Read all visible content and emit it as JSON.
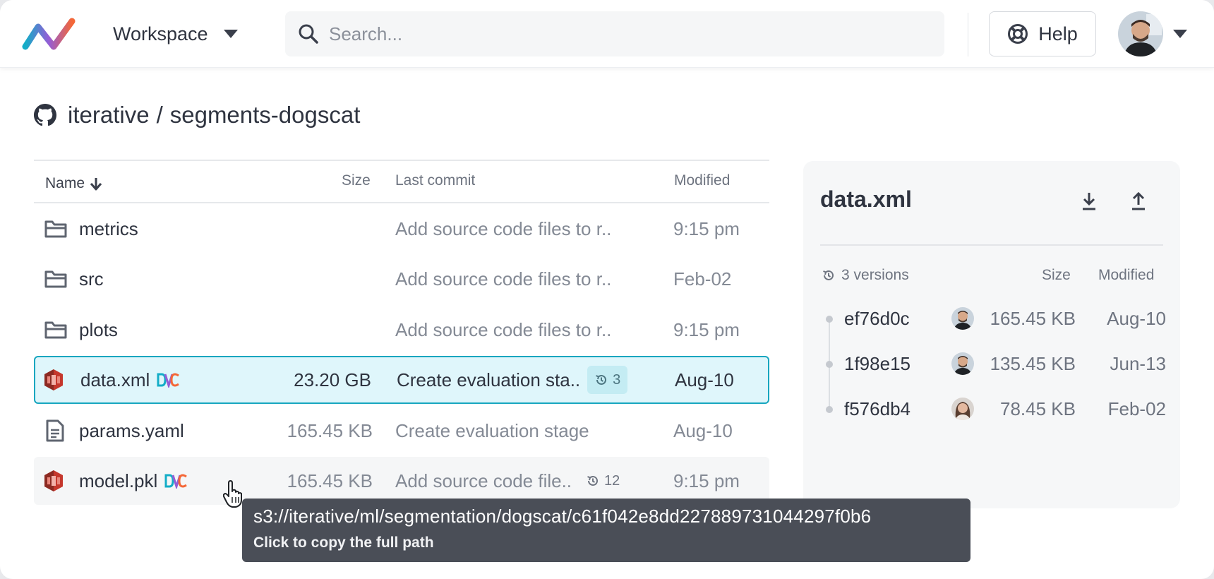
{
  "header": {
    "workspace_label": "Workspace",
    "search_placeholder": "Search...",
    "help_label": "Help"
  },
  "repo": {
    "owner": "iterative",
    "separator": "/",
    "name": "segments-dogscat"
  },
  "table": {
    "columns": {
      "name": "Name",
      "size": "Size",
      "last_commit": "Last commit",
      "modified": "Modified"
    },
    "rows": [
      {
        "name": "metrics",
        "type": "folder",
        "size": "",
        "commit": "Add source code files to r..",
        "modified": "9:15 pm"
      },
      {
        "name": "src",
        "type": "folder",
        "size": "",
        "commit": "Add source code files to r..",
        "modified": "Feb-02"
      },
      {
        "name": "plots",
        "type": "folder",
        "size": "",
        "commit": "Add source code files to r..",
        "modified": "9:15 pm"
      },
      {
        "name": "data.xml",
        "type": "s3-file",
        "dvc": true,
        "size": "23.20 GB",
        "commit": "Create evaluation sta..",
        "versions": "3",
        "modified": "Aug-10",
        "selected": true
      },
      {
        "name": "params.yaml",
        "type": "document",
        "size": "165.45 KB",
        "commit": "Create evaluation stage",
        "modified": "Aug-10"
      },
      {
        "name": "model.pkl",
        "type": "s3-file",
        "dvc": true,
        "size": "165.45 KB",
        "commit": "Add source code file..",
        "versions": "12",
        "modified": "9:15 pm",
        "hover": true
      }
    ]
  },
  "tooltip": {
    "path": "s3://iterative/ml/segmentation/dogscat/c61f042e8dd227889731044297f0b6",
    "hint": "Click to copy the full path"
  },
  "panel": {
    "title": "data.xml",
    "versions_label": "3 versions",
    "size_label": "Size",
    "modified_label": "Modified",
    "versions": [
      {
        "hash": "ef76d0c",
        "size": "165.45 KB",
        "modified": "Aug-10"
      },
      {
        "hash": "1f98e15",
        "size": "135.45 KB",
        "modified": "Jun-13"
      },
      {
        "hash": "f576db4",
        "size": "78.45 KB",
        "modified": "Feb-02"
      }
    ]
  },
  "colors": {
    "accent": "#17a6bf",
    "selected_row_bg": "#dff6fb",
    "s3_icon": "#c5372c",
    "dvc_blue": "#13adc7",
    "dvc_orange": "#f46737",
    "tooltip_bg": "#4a4e57"
  },
  "icons": {
    "logo": "iterative-logo-icon",
    "search": "search-icon",
    "help": "lifebuoy-icon",
    "repo": "github-icon",
    "folder": "folder-icon",
    "s3": "aws-s3-icon",
    "document": "document-icon",
    "dvc": "dvc-icon",
    "history": "history-icon",
    "download": "download-icon",
    "upload": "upload-icon"
  }
}
